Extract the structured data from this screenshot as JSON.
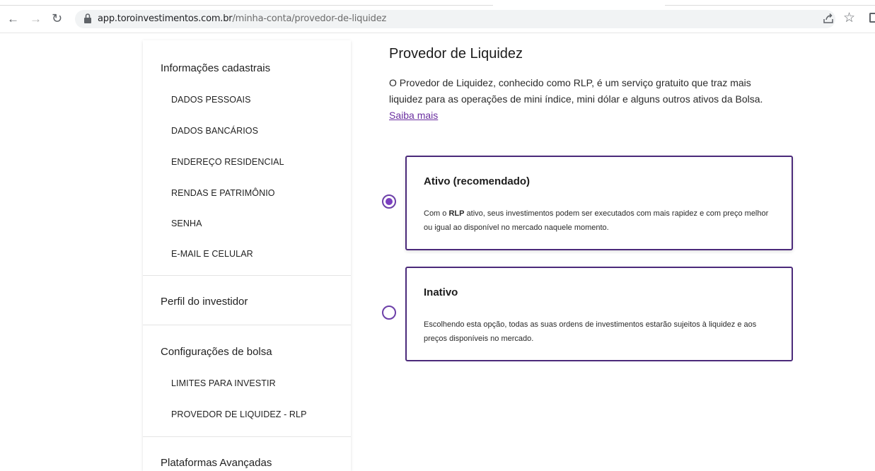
{
  "browser": {
    "url_domain": "app.toroinvestimentos.com.br",
    "url_path": "/minha-conta/provedor-de-liquidez"
  },
  "sidebar": {
    "sections": [
      {
        "title": "Informações cadastrais",
        "items": [
          "DADOS PESSOAIS",
          "DADOS BANCÁRIOS",
          "ENDEREÇO RESIDENCIAL",
          "RENDAS E PATRIMÔNIO",
          "SENHA",
          "E-MAIL E CELULAR"
        ]
      },
      {
        "title": "Perfil do investidor",
        "items": []
      },
      {
        "title": "Configurações de bolsa",
        "items": [
          "LIMITES PARA INVESTIR",
          "PROVEDOR DE LIQUIDEZ - RLP"
        ]
      },
      {
        "title": "Plataformas Avançadas",
        "items": []
      }
    ]
  },
  "main": {
    "title": "Provedor de Liquidez",
    "description": "O Provedor de Liquidez, conhecido como RLP, é um serviço gratuito que traz mais liquidez para as operações de mini índice, mini dólar e alguns outros ativos da Bolsa.",
    "link_label": "Saiba mais",
    "options": [
      {
        "title": "Ativo (recomendado)",
        "desc_prefix": "Com o ",
        "desc_bold": "RLP",
        "desc_suffix": " ativo, seus investimentos podem ser executados com mais rapidez e com preço melhor ou igual ao disponível no mercado naquele momento.",
        "selected": true
      },
      {
        "title": "Inativo",
        "desc": "Escolhendo esta opção, todas as suas ordens de investimentos estarão sujeitos à liquidez e aos preços disponíveis no mercado.",
        "selected": false
      }
    ]
  },
  "colors": {
    "accent": "#7b3fc0",
    "card_border": "#4b2a7a",
    "link": "#6a2fa0"
  }
}
